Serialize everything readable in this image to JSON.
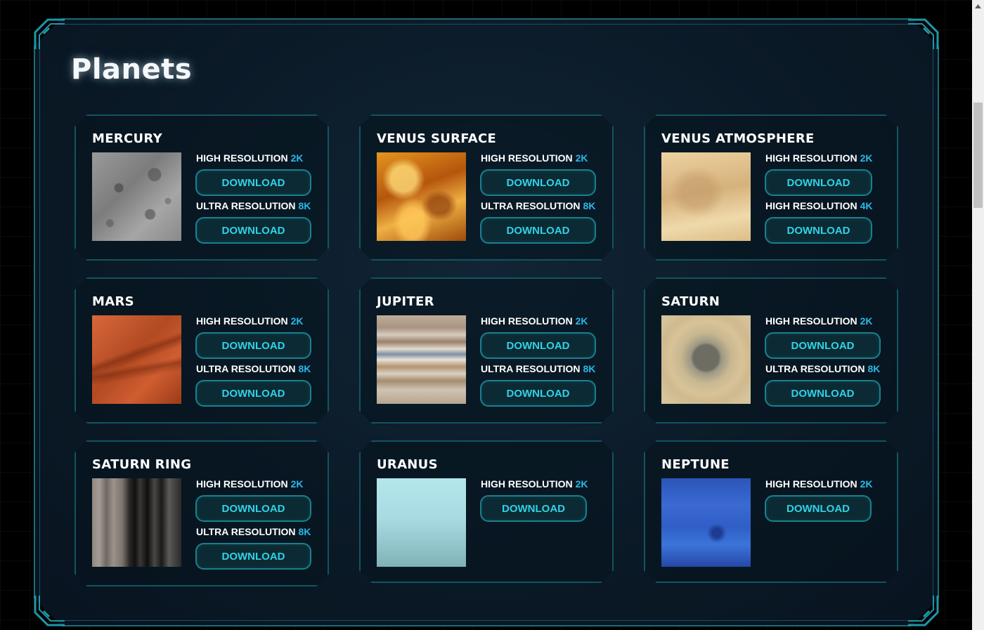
{
  "page": {
    "title": "Planets"
  },
  "colors": {
    "accent": "#29b8e8",
    "button_text": "#2fd2e6",
    "border": "#1a8090"
  },
  "cards": [
    {
      "name": "MERCURY",
      "texture": "mercury",
      "options": [
        {
          "label": "HIGH RESOLUTION",
          "res": "2K",
          "button": "DOWNLOAD"
        },
        {
          "label": "ULTRA RESOLUTION",
          "res": "8K",
          "button": "DOWNLOAD"
        }
      ]
    },
    {
      "name": "VENUS SURFACE",
      "texture": "venus-s",
      "options": [
        {
          "label": "HIGH RESOLUTION",
          "res": "2K",
          "button": "DOWNLOAD"
        },
        {
          "label": "ULTRA RESOLUTION",
          "res": "8K",
          "button": "DOWNLOAD"
        }
      ]
    },
    {
      "name": "VENUS ATMOSPHERE",
      "texture": "venus-a",
      "options": [
        {
          "label": "HIGH RESOLUTION",
          "res": "2K",
          "button": "DOWNLOAD"
        },
        {
          "label": "HIGH RESOLUTION",
          "res": "4K",
          "button": "DOWNLOAD"
        }
      ]
    },
    {
      "name": "MARS",
      "texture": "mars",
      "options": [
        {
          "label": "HIGH RESOLUTION",
          "res": "2K",
          "button": "DOWNLOAD"
        },
        {
          "label": "ULTRA RESOLUTION",
          "res": "8K",
          "button": "DOWNLOAD"
        }
      ]
    },
    {
      "name": "JUPITER",
      "texture": "jupiter",
      "options": [
        {
          "label": "HIGH RESOLUTION",
          "res": "2K",
          "button": "DOWNLOAD"
        },
        {
          "label": "ULTRA RESOLUTION",
          "res": "8K",
          "button": "DOWNLOAD"
        }
      ]
    },
    {
      "name": "SATURN",
      "texture": "saturn",
      "options": [
        {
          "label": "HIGH RESOLUTION",
          "res": "2K",
          "button": "DOWNLOAD"
        },
        {
          "label": "ULTRA RESOLUTION",
          "res": "8K",
          "button": "DOWNLOAD"
        }
      ]
    },
    {
      "name": "SATURN RING",
      "texture": "ring",
      "options": [
        {
          "label": "HIGH RESOLUTION",
          "res": "2K",
          "button": "DOWNLOAD"
        },
        {
          "label": "ULTRA RESOLUTION",
          "res": "8K",
          "button": "DOWNLOAD"
        }
      ]
    },
    {
      "name": "URANUS",
      "texture": "uranus",
      "options": [
        {
          "label": "HIGH RESOLUTION",
          "res": "2K",
          "button": "DOWNLOAD"
        }
      ]
    },
    {
      "name": "NEPTUNE",
      "texture": "neptune",
      "options": [
        {
          "label": "HIGH RESOLUTION",
          "res": "2K",
          "button": "DOWNLOAD"
        }
      ]
    }
  ]
}
